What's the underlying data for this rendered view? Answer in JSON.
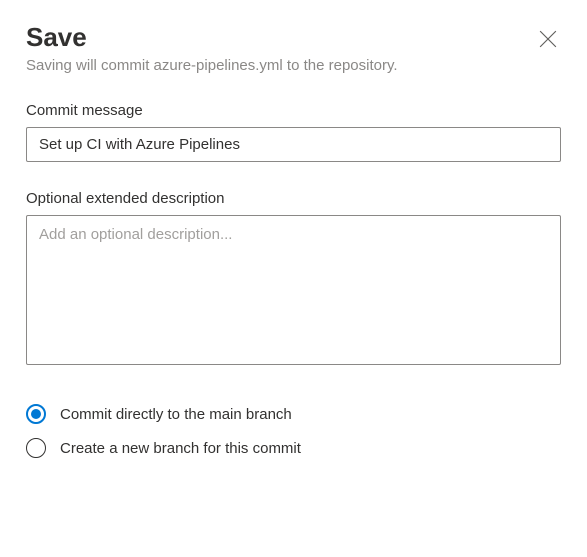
{
  "dialog": {
    "title": "Save",
    "subtitle": "Saving will commit azure-pipelines.yml to the repository."
  },
  "commit_message": {
    "label": "Commit message",
    "value": "Set up CI with Azure Pipelines"
  },
  "extended_description": {
    "label": "Optional extended description",
    "placeholder": "Add an optional description...",
    "value": ""
  },
  "branch_options": {
    "selected": "direct",
    "direct_label": "Commit directly to the main branch",
    "new_branch_label": "Create a new branch for this commit"
  }
}
